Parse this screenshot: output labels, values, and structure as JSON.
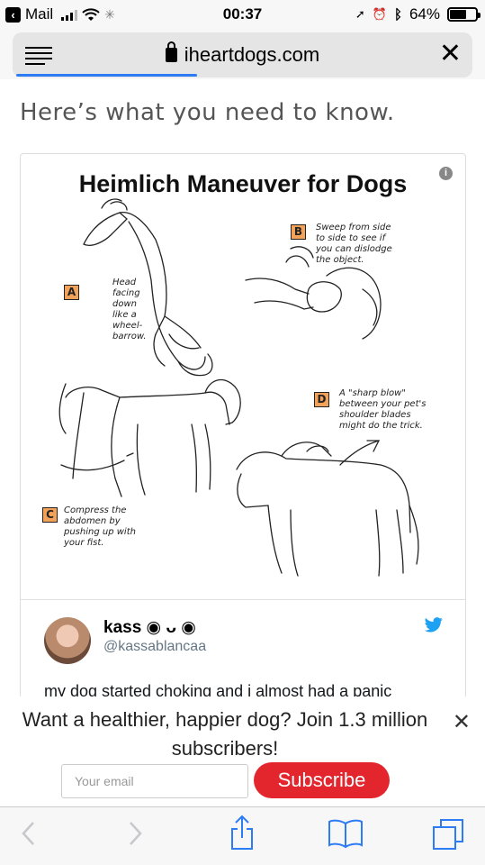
{
  "status_bar": {
    "back_app": "Mail",
    "time": "00:37",
    "battery": "64%",
    "battery_level": 0.64
  },
  "browser": {
    "url": "iheartdogs.com",
    "load_progress": 0.4
  },
  "article": {
    "intro": "Here’s what you need to know."
  },
  "figure": {
    "title": "Heimlich Maneuver for Dogs",
    "steps": [
      {
        "letter": "A",
        "text": "Head facing down like a wheel-barrow."
      },
      {
        "letter": "B",
        "text": "Sweep from side to side to see if you can dislodge the object."
      },
      {
        "letter": "C",
        "text": "Compress the abdomen by pushing up with your fist."
      },
      {
        "letter": "D",
        "text": "A \"sharp blow\" between your pet's shoulder blades might do the trick."
      }
    ]
  },
  "tweet": {
    "name": "kass ◉ ᴗ ◉",
    "handle": "@kassablancaa",
    "text": "my dog started choking and i almost had a panic"
  },
  "newsletter": {
    "headline": "Want a healthier, happier dog? Join 1.3 million subscribers!",
    "email_placeholder": "Your email",
    "subscribe_label": "Subscribe"
  },
  "colors": {
    "progress": "#2d7cf6",
    "subscribe": "#e3262d",
    "twitter": "#1da1f2",
    "step_badge": "#f3a259",
    "toolbar_icon": "#2d7cf6"
  }
}
